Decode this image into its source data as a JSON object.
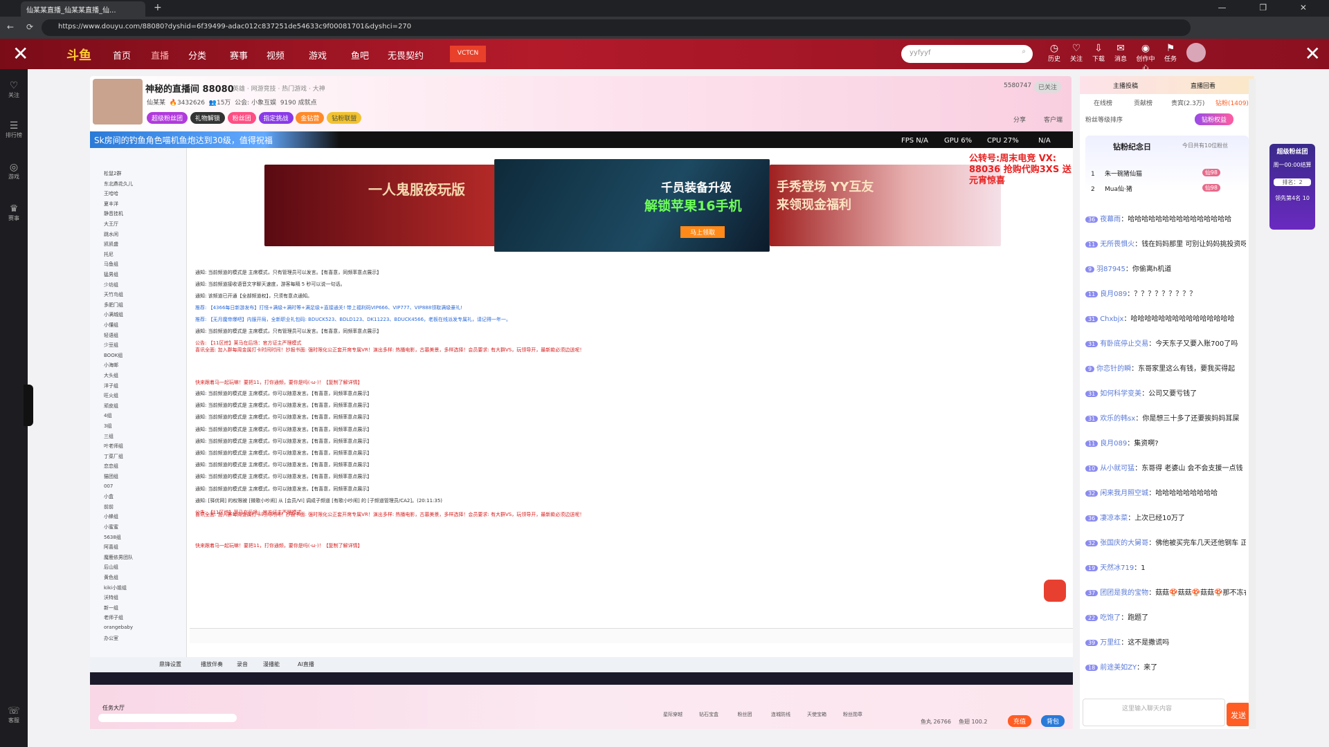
{
  "browser": {
    "tab_title": "仙某某直播_仙某某直播_仙...",
    "url": "https://www.douyu.com/88080?dyshid=6f39499-adac012c837251de54633c9f00081701&dyshci=270",
    "window_controls": "— ❐ ✕"
  },
  "nav": {
    "items": [
      "首页",
      "直播",
      "分类",
      "赛事",
      "视频",
      "游戏",
      "鱼吧",
      "无畏契约"
    ],
    "promo": "VCTCN",
    "search_placeholder": "yyfyyf",
    "icons": [
      "历史",
      "关注",
      "下载",
      "消息",
      "创作中心",
      "任务"
    ]
  },
  "leftbar": {
    "items": [
      "关注",
      "排行榜",
      "游戏",
      "赛事",
      "客服"
    ]
  },
  "room": {
    "title": "神秘的直播间 88080",
    "tags": "英雄 · 网游竞技 · 热门游戏 · 大神",
    "owner": "仙某某",
    "hot": "3432626",
    "fans": "15万",
    "guild": "公会: 小象互娱",
    "level_info": "9190 成就点",
    "follow_count": "5580747",
    "follow_label": "已关注",
    "share": "分享",
    "client": "客户端",
    "badges": [
      "超级粉丝团",
      "礼物解锁",
      "粉丝团",
      "指定挑战",
      "金钻营",
      "钻粉联盟"
    ]
  },
  "game": {
    "marquee": "Sk房间的钓鱼角色喵机鱼炮达到30级，值得祝福",
    "fps": "FPS N/A",
    "gpu": "GPU 6%",
    "cpu": "CPU 27%",
    "net": "N/A"
  },
  "banners": {
    "left_title": "一人鬼服夜玩版",
    "mid_title": "千员装备升级",
    "mid_sub": "解锁苹果16手机",
    "mid_btn": "马上领取",
    "right_title": "手秀登场 YY互友",
    "right_sub": "来领现金福利",
    "corner": "公转号:周末电竞 VX: 88036 抢购代购3XS 送元宵惊喜"
  },
  "tree": [
    "松鼠2群",
    "东北鼎花久儿",
    "王哈哈",
    "夏丰洋",
    "静音挂机",
    "大王厅",
    "跳水闲",
    "凯凯盛",
    "托尼",
    "马鱼组",
    "猛男组",
    "少坊组",
    "天竹鸟组",
    "多肥门组",
    "小满城组",
    "小懂组",
    "轻语组",
    "少豆组",
    "BOOK组",
    "小海邮",
    "大头组",
    "洋子组",
    "旺火组",
    "顽皮组",
    "4组",
    "3组",
    "三组",
    "叶老师组",
    "丁菜厂组",
    "恋恋组",
    "猫团组",
    "007",
    "小盒",
    "前前",
    "小蜂组",
    "小蜜蜜",
    "5638组",
    "阿喜组",
    "魔鹿依男团队",
    "后山组",
    "黄色组",
    "kiki小姐组",
    "沃特组",
    "新一组",
    "老师子组",
    "orangebaby",
    "办公室"
  ],
  "messages": [
    {
      "text": "通知: 当前频道的模式是 主席模式，只有管理员可以发言。【有喜意，同频率意点展示】",
      "color": "#333"
    },
    {
      "text": "通知: 当前频道接收语音文字聊天速度，游客每隔 5 秒可以说一句话。",
      "color": "#333"
    },
    {
      "text": "通知: 该频道已开通【全部频道权】，只须有意点通知。",
      "color": "#333"
    },
    {
      "text": "推荐: 【4366每日新游发布】打怪+满级+满时等+满足级+直接通关! 带上福利码VIP666、VIP777、VIP888领取满级豪礼!",
      "color": "#2a6ad8"
    },
    {
      "text": "推荐: 【无月魔帝爆吧】内服开局，全新职业礼包码: BDUCK523、BDLD123、DK11223、BDUCK4566，老板在线派发专属礼，请记得一年一。",
      "color": "#2a6ad8"
    },
    {
      "text": "通知: 当前频道的模式是 主席模式，只有管理员可以发言。【有喜意，同频率意点展示】",
      "color": "#333"
    },
    {
      "text": "公告: 【11区挖】莱马在后场：官方证主严理模式",
      "color": "#d62020"
    },
    {
      "text": "通知: 当前频道的模式是 主席模式，你可以随意发言。【有喜意，同频率意点展示】",
      "color": "#333"
    },
    {
      "text": "通知: 当前频道的模式是 主席模式，你可以随意发言。【有喜意，同频率意点展示】",
      "color": "#333"
    },
    {
      "text": "通知: 当前频道的模式是 主席模式，你可以随意发言。【有喜意，同频率意点展示】",
      "color": "#333"
    },
    {
      "text": "通知: 当前频道的模式是 主席模式，你可以随意发言。【有喜意，同频率意点展示】",
      "color": "#333"
    },
    {
      "text": "通知: 当前频道的模式是 主席模式，你可以随意发言。【有喜意，同频率意点展示】",
      "color": "#333"
    },
    {
      "text": "通知: 当前频道的模式是 主席模式，你可以随意发言。【有喜意，同频率意点展示】",
      "color": "#333"
    },
    {
      "text": "通知: 当前频道的模式是 主席模式，你可以随意发言。【有喜意，同频率意点展示】",
      "color": "#333"
    },
    {
      "text": "通知: 当前频道的模式是 主席模式，你可以随意发言。【有喜意，同频率意点展示】",
      "color": "#333"
    },
    {
      "text": "通知: 当前频道的模式是 主席模式，你可以随意发言。【有喜意，同频率意点展示】",
      "color": "#333"
    },
    {
      "text": "通知: [驿优网] 的权限被 [微歌小吵闹] 从 [会员/Vi] 调成子频道 [有歌小吵闹] 的 [子频道管理员/CA2]。(20:11:35)",
      "color": "#333"
    },
    {
      "text": "公告: 【11区挖】莱马在后场：官方证主严理模式",
      "color": "#d62020"
    }
  ],
  "notices": {
    "red_block": "喜讯全面: 加入群每周金属打卡时间时间！抄报书面: 强时限化公正套开席专属VR！演出多样: 热播电影，古墓美景，多样选择！会员要求: 有大群VS，玩领导开，最新款必须边送呢！",
    "red_tail": "快来跟着马一起玩嘛！要把11，打你通频，要你是吗(·ω·)！【复制了解详情】"
  },
  "gamebar": {
    "items": [
      "鼎锋设置",
      "播放伴奏",
      "录音",
      "漫播能",
      "AI直播"
    ]
  },
  "bottom": {
    "task": "任务大厅",
    "gift_labels": [
      "星际穿越",
      "钻石宝盒",
      "粉丝团",
      "连城防线",
      "天使宝箱",
      "粉丝勋章"
    ],
    "fishball": "鱼丸 26766",
    "fishbar": "鱼翅 100.2",
    "recharge": "充值",
    "backpack": "背包"
  },
  "side": {
    "tabs": [
      "主播投稿",
      "直播回看"
    ],
    "subtabs": [
      "在线榜",
      "贡献榜",
      "贵宾(2.3万)",
      "钻粉(1409)"
    ],
    "rank_title": "粉丝等级排序",
    "rank_btn": "钻粉权益",
    "anniv": "钻粉纪念日",
    "anniv_sub": "今日共有10位粉丝",
    "ranks": [
      {
        "n": "1",
        "name": "朱一碗猪仙猫",
        "lv": "仙98"
      },
      {
        "n": "2",
        "name": "Mua仙·猪",
        "lv": "仙98"
      }
    ],
    "chat": [
      {
        "user": "夜幕雨",
        "text": "哈哈哈哈哈哈哈哈哈哈哈哈哈哈哈",
        "lv": "36"
      },
      {
        "user": "无所畏惧火",
        "text": "钱在妈妈那里 可别让妈妈挑投资呀",
        "lv": "11"
      },
      {
        "user": "羽87945",
        "text": "你偷离h机道",
        "lv": "9"
      },
      {
        "user": "良月089",
        "text": "？？？？？？？？？",
        "lv": "11"
      },
      {
        "user": "Chxbjx",
        "text": "哈哈哈哈哈哈哈哈哈哈哈哈哈哈哈",
        "lv": "31"
      },
      {
        "user": "有卧底停止交易",
        "text": "今天东子又要入账700了吗",
        "lv": "31"
      },
      {
        "user": "你恋针的瞬",
        "text": "东哥家里这么有钱，要我买得起",
        "lv": "9"
      },
      {
        "user": "如何科学变美",
        "text": "公司又要亏钱了",
        "lv": "31"
      },
      {
        "user": "欢乐的韩sx",
        "text": "你是想三十多了还要挨妈妈耳屎",
        "lv": "31"
      },
      {
        "user": "良月089",
        "text": "集资啊?",
        "lv": "11"
      },
      {
        "user": "从小就可猛",
        "text": "东哥得 老婆山 会不会支援一点钱",
        "lv": "10"
      },
      {
        "user": "闲来我月照空城",
        "text": "哈哈哈哈哈哈哈哈哈",
        "lv": "32"
      },
      {
        "user": "凄凉本菜",
        "text": "上次已经10万了",
        "lv": "36"
      },
      {
        "user": "张国庆的大舅哥",
        "text": "佛他被买完车几天还他钢车 正合适",
        "lv": "32"
      },
      {
        "user": "天然冰719",
        "text": "1",
        "lv": "19"
      },
      {
        "user": "团团是我的宝物",
        "text": "菇菇🍄菇菇🍄菇菇🍄那不冻衣",
        "lv": "37"
      },
      {
        "user": "吃饱了",
        "text": "跑题了",
        "lv": "22"
      },
      {
        "user": "万里红",
        "text": "这不是撒谎吗",
        "lv": "39"
      },
      {
        "user": "前途美如ZY",
        "text": "来了",
        "lv": "18"
      }
    ],
    "input_placeholder": "这里输入聊天内容",
    "send": "发送",
    "float_title": "超级粉丝团",
    "float_sub": "周一00:00结算",
    "float_rank": "排名：2",
    "float_foot": "领先第4名 10"
  }
}
